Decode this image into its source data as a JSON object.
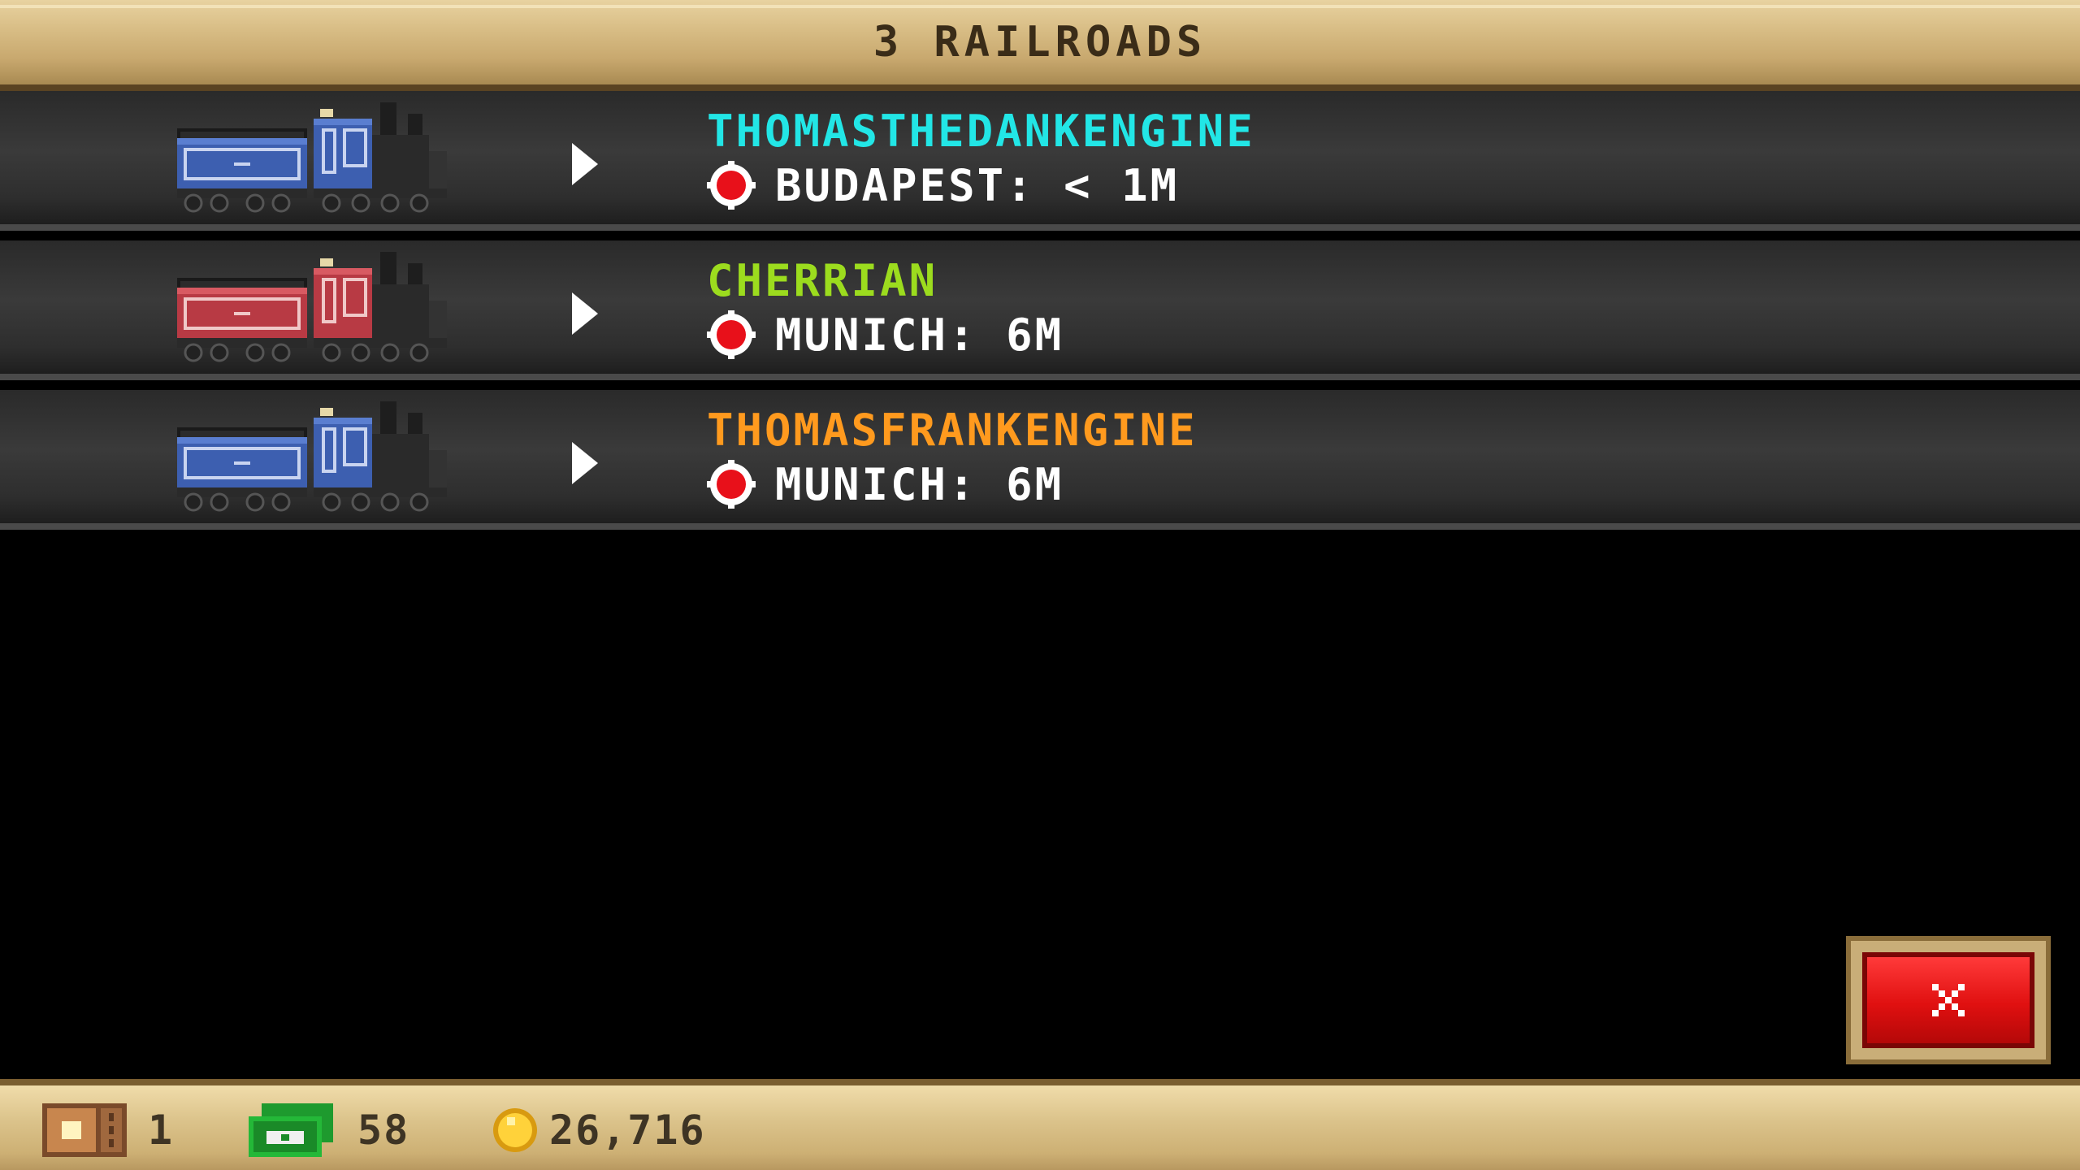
{
  "header": {
    "title": "3 RAILROADS"
  },
  "railroads": [
    {
      "name": "THOMASTHEDANKENGINE",
      "name_color": "#22e6e6",
      "location": "BUDAPEST: < 1M",
      "train_color": "blue"
    },
    {
      "name": "CHERRIAN",
      "name_color": "#9cdc1e",
      "location": "MUNICH: 6M",
      "train_color": "red"
    },
    {
      "name": "THOMASFRANKENGINE",
      "name_color": "#ff9a1e",
      "location": "MUNICH: 6M",
      "train_color": "blue"
    }
  ],
  "close_button": {
    "icon": "close-icon"
  },
  "footer": {
    "tickets": "1",
    "cash": "58",
    "coins": "26,716",
    "tickets_icon": "ticket-icon",
    "cash_icon": "cash-icon",
    "coins_icon": "coin-icon"
  },
  "colors": {
    "header_bg": "#d8bd85",
    "row_bg": "#333333",
    "close_red": "#e01010",
    "pin_red": "#e8101a"
  }
}
